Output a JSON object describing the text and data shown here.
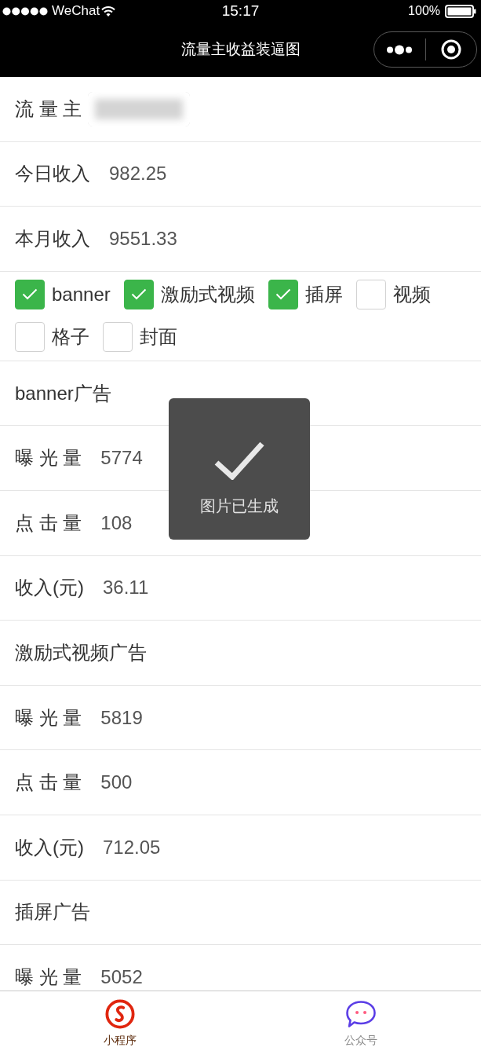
{
  "status_bar": {
    "carrier": "WeChat",
    "time": "15:17",
    "battery": "100%"
  },
  "nav_bar": {
    "title": "流量主收益装逼图"
  },
  "summary": [
    {
      "kind": "blurred",
      "label": "流 量 主"
    },
    {
      "kind": "text",
      "label": "今日收入",
      "value": "982.25"
    },
    {
      "kind": "text",
      "label": "本月收入",
      "value": "9551.33"
    }
  ],
  "ad_types": [
    {
      "label": "banner",
      "checked": true
    },
    {
      "label": "激励式视频",
      "checked": true
    },
    {
      "label": "插屏",
      "checked": true
    },
    {
      "label": "视频",
      "checked": false
    },
    {
      "label": "格子",
      "checked": false
    },
    {
      "label": "封面",
      "checked": false
    }
  ],
  "sections": [
    {
      "title": "banner广告",
      "rows": [
        {
          "label": "曝 光 量",
          "value": "5774"
        },
        {
          "label": "点 击 量",
          "value": "108"
        },
        {
          "label": "收入(元)",
          "value": "36.11"
        }
      ]
    },
    {
      "title": "激励式视频广告",
      "rows": [
        {
          "label": "曝 光 量",
          "value": "5819"
        },
        {
          "label": "点 击 量",
          "value": "500"
        },
        {
          "label": "收入(元)",
          "value": "712.05"
        }
      ]
    },
    {
      "title": "插屏广告",
      "rows": [
        {
          "label": "曝 光 量",
          "value": "5052"
        }
      ]
    }
  ],
  "toast": {
    "message": "图片已生成"
  },
  "tab_bar": [
    {
      "label": "小程序",
      "selected": true
    },
    {
      "label": "公众号",
      "selected": false
    }
  ]
}
